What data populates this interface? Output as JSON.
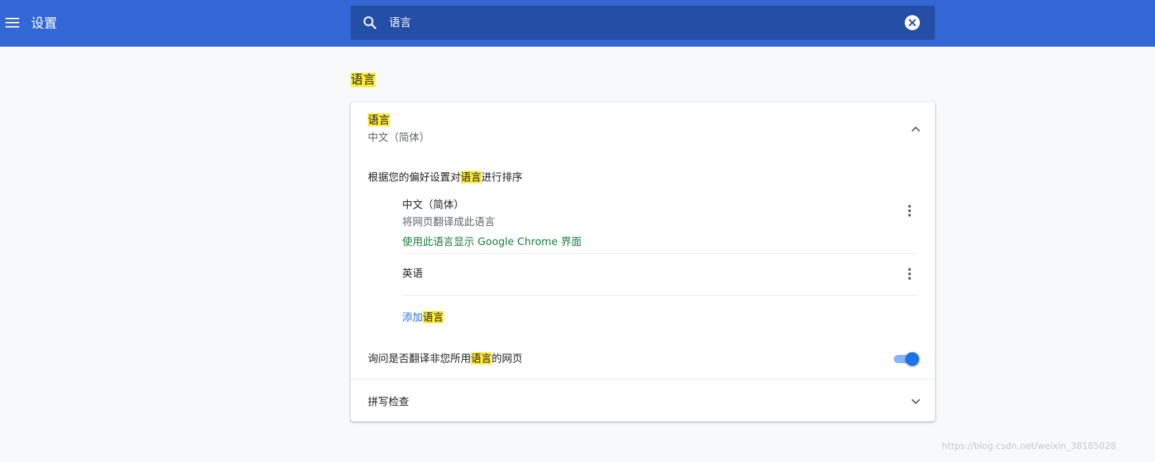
{
  "toolbar": {
    "title": "设置",
    "search": {
      "value": "语言"
    }
  },
  "section": {
    "title": "语言"
  },
  "languages_card": {
    "title": "语言",
    "current": "中文（简体）",
    "order_label": {
      "before": "根据您的偏好设置对",
      "highlight": "语言",
      "after": "进行排序"
    },
    "items": [
      {
        "name": "中文（简体）",
        "desc": "将网页翻译成此语言",
        "ui_note": "使用此语言显示 Google Chrome 界面"
      },
      {
        "name": "英语"
      }
    ],
    "add": {
      "before": "添加",
      "highlight": "语言"
    },
    "translate_prompt": {
      "before": "询问是否翻译非您所用",
      "highlight": "语言",
      "after": "的网页",
      "enabled": true
    }
  },
  "spellcheck": {
    "title": "拼写检查"
  },
  "watermark": "https://blog.csdn.net/weixin_38185028",
  "colors": {
    "toolbar": "#3367d6",
    "search_bg": "#254fa7",
    "highlight": "#ffeb3b",
    "accent": "#1a73e8",
    "ui_note": "#188038"
  }
}
